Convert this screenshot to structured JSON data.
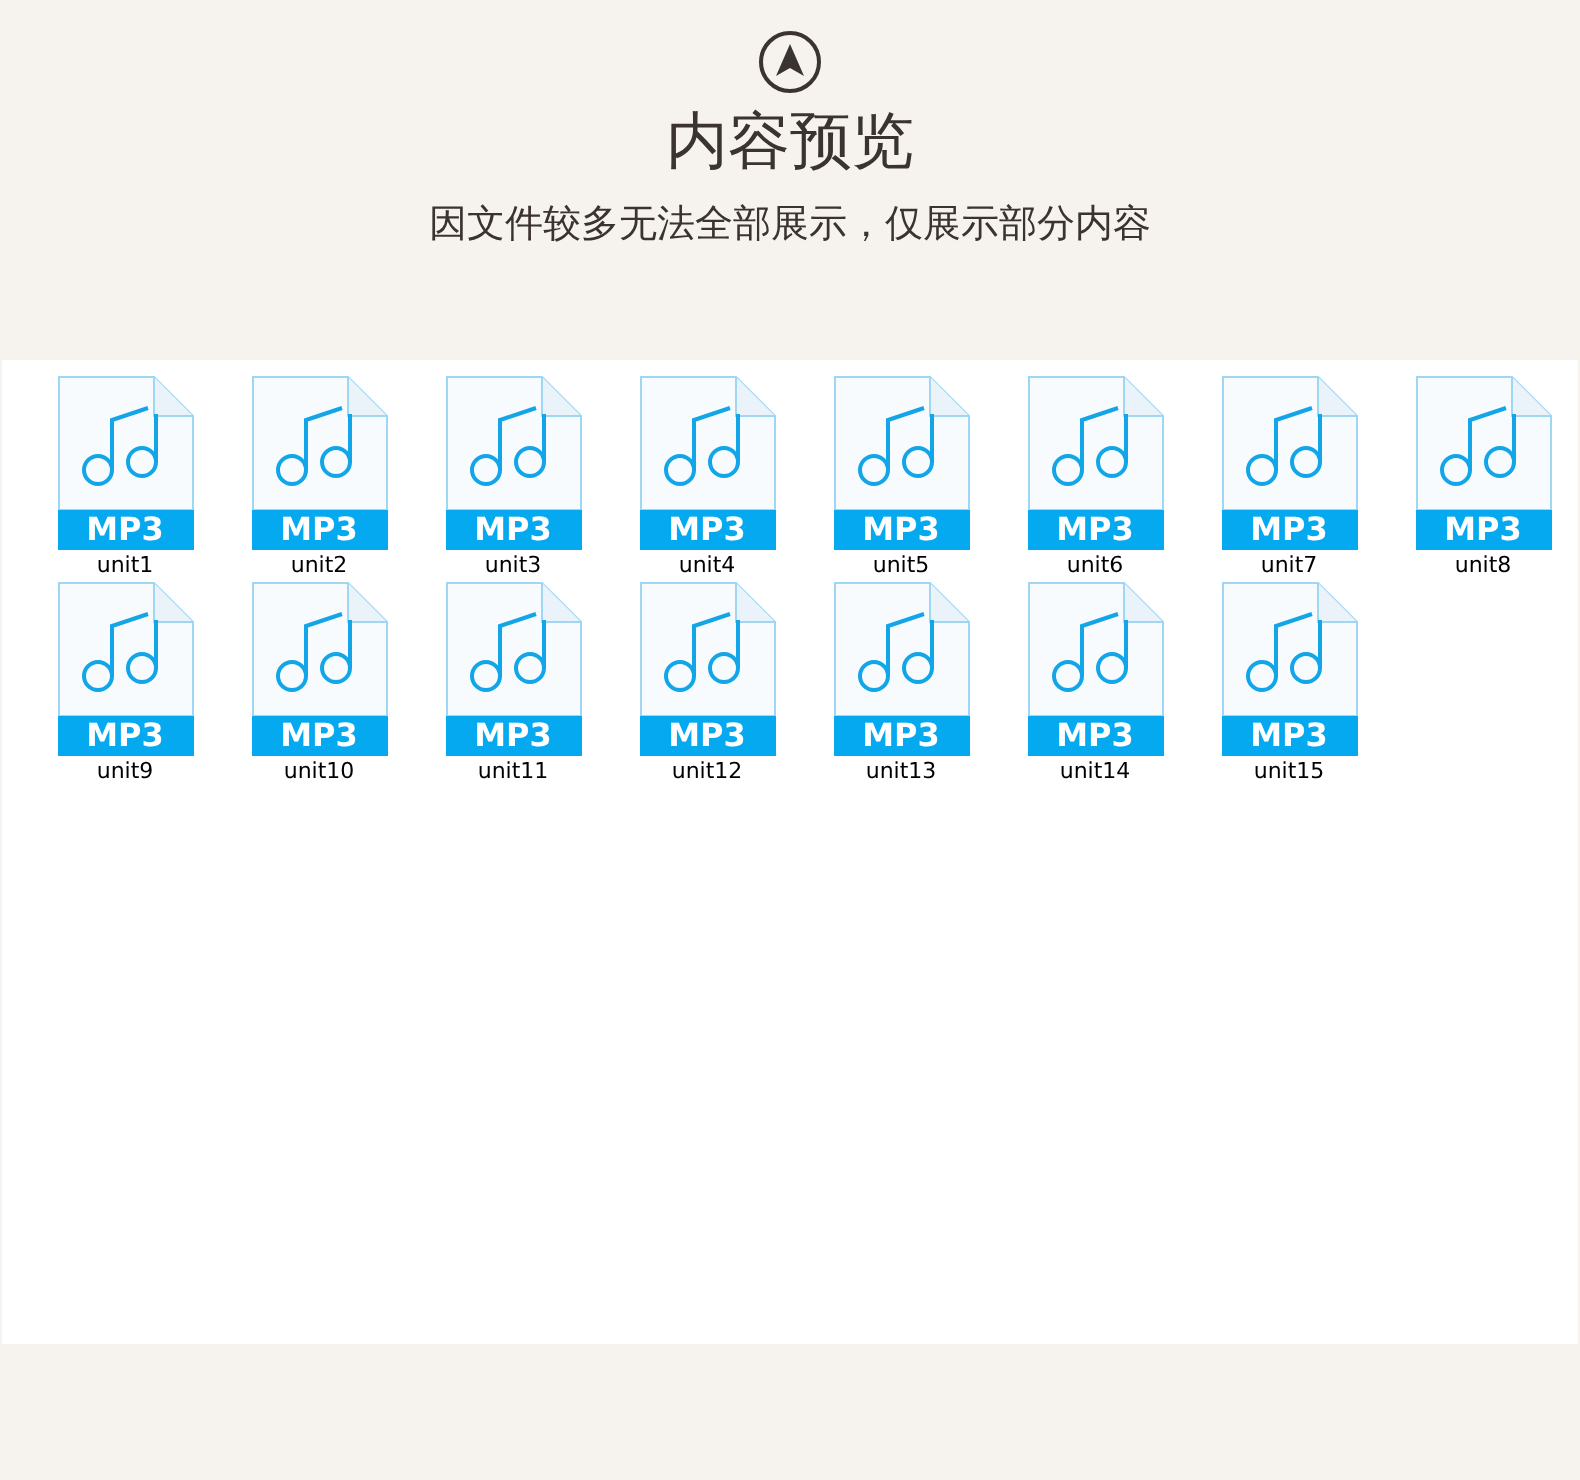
{
  "header": {
    "title": "内容预览",
    "subtitle": "因文件较多无法全部展示，仅展示部分内容"
  },
  "files": [
    {
      "type": "MP3",
      "name": "unit1"
    },
    {
      "type": "MP3",
      "name": "unit2"
    },
    {
      "type": "MP3",
      "name": "unit3"
    },
    {
      "type": "MP3",
      "name": "unit4"
    },
    {
      "type": "MP3",
      "name": "unit5"
    },
    {
      "type": "MP3",
      "name": "unit6"
    },
    {
      "type": "MP3",
      "name": "unit7"
    },
    {
      "type": "MP3",
      "name": "unit8"
    },
    {
      "type": "MP3",
      "name": "unit9"
    },
    {
      "type": "MP3",
      "name": "unit10"
    },
    {
      "type": "MP3",
      "name": "unit11"
    },
    {
      "type": "MP3",
      "name": "unit12"
    },
    {
      "type": "MP3",
      "name": "unit13"
    },
    {
      "type": "MP3",
      "name": "unit14"
    },
    {
      "type": "MP3",
      "name": "unit15"
    }
  ]
}
